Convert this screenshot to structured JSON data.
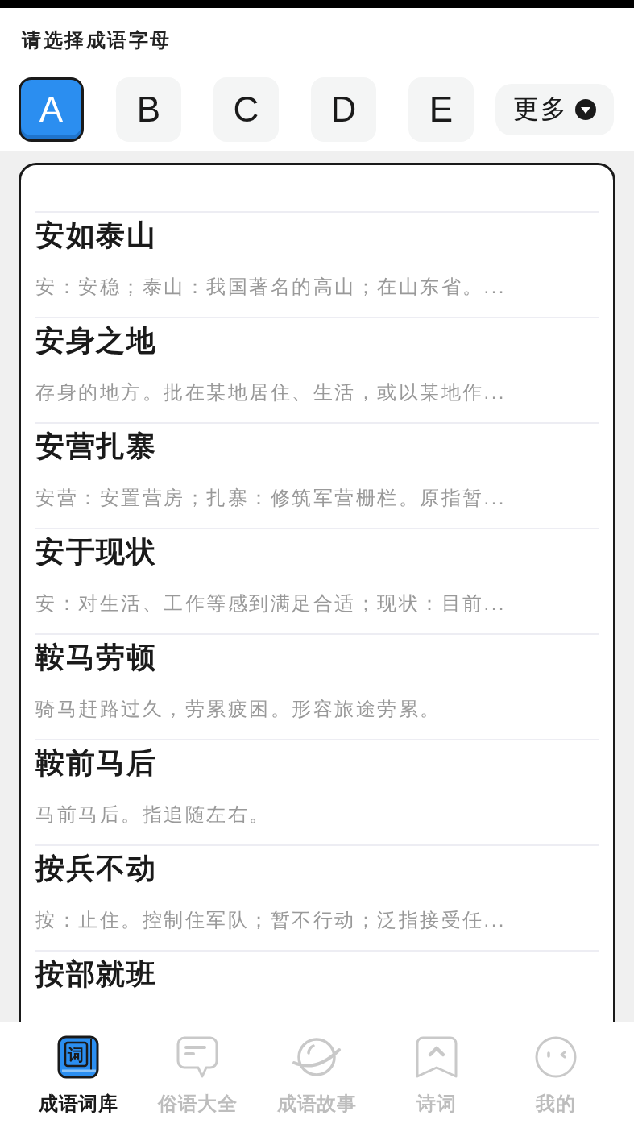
{
  "header": {
    "title": "请选择成语字母"
  },
  "letters": [
    {
      "label": "A",
      "selected": true
    },
    {
      "label": "B",
      "selected": false
    },
    {
      "label": "C",
      "selected": false
    },
    {
      "label": "D",
      "selected": false
    },
    {
      "label": "E",
      "selected": false
    }
  ],
  "more_button": {
    "label": "更多"
  },
  "idioms": [
    {
      "title": "安如泰山",
      "description": "安：安稳；泰山：我国著名的高山；在山东省。..."
    },
    {
      "title": "安身之地",
      "description": "存身的地方。批在某地居住、生活，或以某地作..."
    },
    {
      "title": "安营扎寨",
      "description": "安营：安置营房；扎寨：修筑军营栅栏。原指暂..."
    },
    {
      "title": "安于现状",
      "description": "安：对生活、工作等感到满足合适；现状：目前..."
    },
    {
      "title": "鞍马劳顿",
      "description": "骑马赶路过久，劳累疲困。形容旅途劳累。"
    },
    {
      "title": "鞍前马后",
      "description": "马前马后。指追随左右。"
    },
    {
      "title": "按兵不动",
      "description": "按：止住。控制住军队；暂不行动；泛指接受任..."
    },
    {
      "title": "按部就班"
    }
  ],
  "tabs": [
    {
      "label": "成语词库",
      "selected": true,
      "icon_text": "词"
    },
    {
      "label": "俗语大全",
      "selected": false
    },
    {
      "label": "成语故事",
      "selected": false
    },
    {
      "label": "诗词",
      "selected": false
    },
    {
      "label": "我的",
      "selected": false
    }
  ]
}
